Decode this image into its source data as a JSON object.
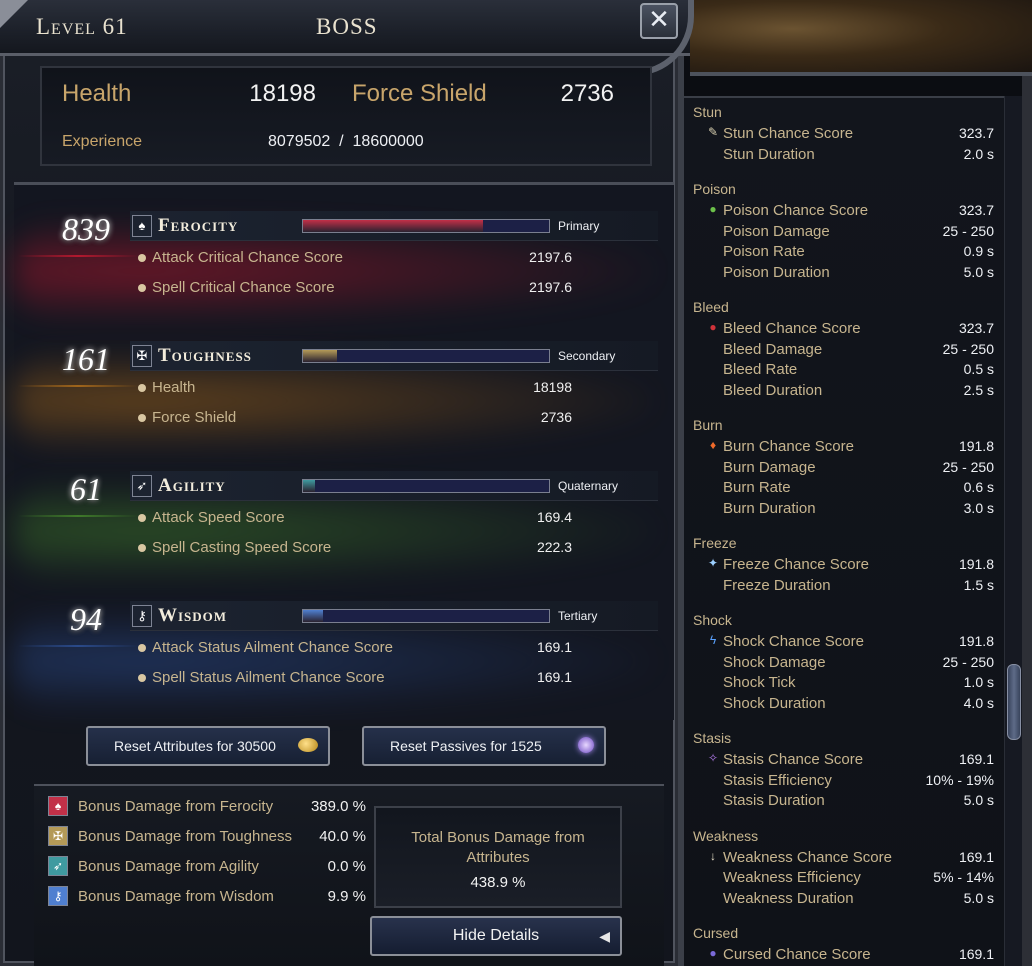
{
  "header": {
    "level": "Level 61",
    "boss": "BOSS",
    "close": "✕"
  },
  "vitals": {
    "health_label": "Health",
    "health_value": "18198",
    "shield_label": "Force Shield",
    "shield_value": "2736",
    "exp_label": "Experience",
    "exp_value": "8079502  /  18600000"
  },
  "attributes": [
    {
      "value": "839",
      "name": "Ferocity",
      "rank": "Primary",
      "bar_fraction": 0.73,
      "fill_color": "#c23048",
      "glow_color": "#b2182e",
      "icon": "ferocity-icon",
      "stats": [
        {
          "label": "Attack Critical Chance Score",
          "value": "2197.6"
        },
        {
          "label": "Spell Critical Chance Score",
          "value": "2197.6"
        }
      ]
    },
    {
      "value": "161",
      "name": "Toughness",
      "rank": "Secondary",
      "bar_fraction": 0.14,
      "fill_color": "#b49a58",
      "glow_color": "#a0651b",
      "icon": "toughness-icon",
      "stats": [
        {
          "label": "Health",
          "value": "18198"
        },
        {
          "label": "Force Shield",
          "value": "2736"
        }
      ]
    },
    {
      "value": "61",
      "name": "Agility",
      "rank": "Quaternary",
      "bar_fraction": 0.05,
      "fill_color": "#3f9aa0",
      "glow_color": "#3f7a2a",
      "icon": "agility-icon",
      "stats": [
        {
          "label": "Attack Speed Score",
          "value": "169.4"
        },
        {
          "label": "Spell Casting Speed Score",
          "value": "222.3"
        }
      ]
    },
    {
      "value": "94",
      "name": "Wisdom",
      "rank": "Tertiary",
      "bar_fraction": 0.08,
      "fill_color": "#4f7fd0",
      "glow_color": "#2a4a8a",
      "icon": "wisdom-icon",
      "stats": [
        {
          "label": "Attack Status Ailment Chance Score",
          "value": "169.1"
        },
        {
          "label": "Spell Status Ailment Chance Score",
          "value": "169.1"
        }
      ]
    }
  ],
  "buttons": {
    "reset_attributes": "Reset Attributes for 30500",
    "reset_passives": "Reset Passives for 1525",
    "hide_details": "Hide Details",
    "hide_arrow": "◀"
  },
  "bonus": [
    {
      "label": "Bonus Damage from Ferocity",
      "value": "389.0 %"
    },
    {
      "label": "Bonus Damage from Toughness",
      "value": "40.0 %"
    },
    {
      "label": "Bonus Damage from Agility",
      "value": "0.0 %"
    },
    {
      "label": "Bonus Damage from Wisdom",
      "value": "9.9 %"
    }
  ],
  "total": {
    "label": "Total Bonus Damage from Attributes",
    "value": "438.9 %"
  },
  "ailments": [
    {
      "group": "Stun",
      "rows": [
        {
          "label": "Stun Chance Score",
          "value": "323.7",
          "icon": "stun-icon",
          "icon_glyph": "✎",
          "icon_color": "#d9d0b0"
        },
        {
          "label": "Stun Duration",
          "value": "2.0 s"
        }
      ]
    },
    {
      "group": "Poison",
      "rows": [
        {
          "label": "Poison Chance Score",
          "value": "323.7",
          "icon": "poison-icon",
          "icon_glyph": "●",
          "icon_color": "#6cc04a"
        },
        {
          "label": "Poison Damage",
          "value": "25 - 250"
        },
        {
          "label": "Poison Rate",
          "value": "0.9 s"
        },
        {
          "label": "Poison Duration",
          "value": "5.0 s"
        }
      ]
    },
    {
      "group": "Bleed",
      "rows": [
        {
          "label": "Bleed Chance Score",
          "value": "323.7",
          "icon": "bleed-icon",
          "icon_glyph": "●",
          "icon_color": "#d0333a"
        },
        {
          "label": "Bleed Damage",
          "value": "25 - 250"
        },
        {
          "label": "Bleed Rate",
          "value": "0.5 s"
        },
        {
          "label": "Bleed Duration",
          "value": "2.5 s"
        }
      ]
    },
    {
      "group": "Burn",
      "rows": [
        {
          "label": "Burn Chance Score",
          "value": "191.8",
          "icon": "burn-icon",
          "icon_glyph": "♦",
          "icon_color": "#f06a2a"
        },
        {
          "label": "Burn Damage",
          "value": "25 - 250"
        },
        {
          "label": "Burn Rate",
          "value": "0.6 s"
        },
        {
          "label": "Burn Duration",
          "value": "3.0 s"
        }
      ]
    },
    {
      "group": "Freeze",
      "rows": [
        {
          "label": "Freeze Chance Score",
          "value": "191.8",
          "icon": "freeze-icon",
          "icon_glyph": "✦",
          "icon_color": "#9cd0ff"
        },
        {
          "label": "Freeze Duration",
          "value": "1.5 s"
        }
      ]
    },
    {
      "group": "Shock",
      "rows": [
        {
          "label": "Shock Chance Score",
          "value": "191.8",
          "icon": "shock-icon",
          "icon_glyph": "ϟ",
          "icon_color": "#5aa2ff"
        },
        {
          "label": "Shock Damage",
          "value": "25 - 250"
        },
        {
          "label": "Shock Tick",
          "value": "1.0 s"
        },
        {
          "label": "Shock Duration",
          "value": "4.0 s"
        }
      ]
    },
    {
      "group": "Stasis",
      "rows": [
        {
          "label": "Stasis Chance Score",
          "value": "169.1",
          "icon": "stasis-icon",
          "icon_glyph": "✧",
          "icon_color": "#b07ae8"
        },
        {
          "label": "Stasis Efficiency",
          "value": "10% - 19%"
        },
        {
          "label": "Stasis Duration",
          "value": "5.0 s"
        }
      ]
    },
    {
      "group": "Weakness",
      "rows": [
        {
          "label": "Weakness Chance Score",
          "value": "169.1",
          "icon": "weakness-icon",
          "icon_glyph": "↓",
          "icon_color": "#e8e0c8"
        },
        {
          "label": "Weakness Efficiency",
          "value": "5% - 14%"
        },
        {
          "label": "Weakness Duration",
          "value": "5.0 s"
        }
      ]
    },
    {
      "group": "Cursed",
      "rows": [
        {
          "label": "Cursed Chance Score",
          "value": "169.1",
          "icon": "cursed-icon",
          "icon_glyph": "●",
          "icon_color": "#7a6ad8"
        }
      ]
    }
  ]
}
